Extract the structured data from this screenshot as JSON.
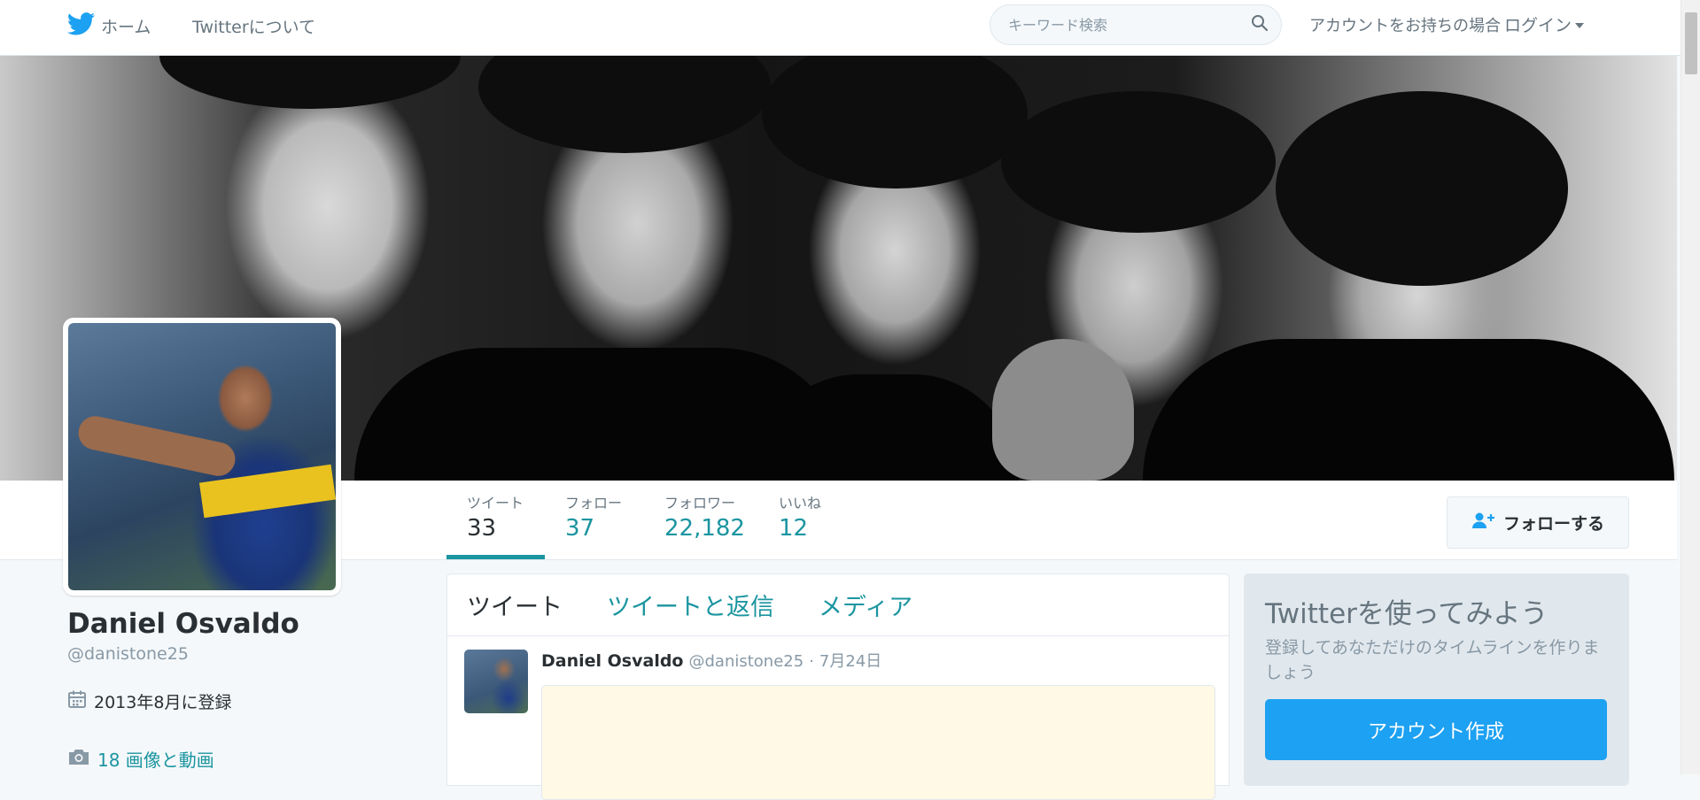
{
  "nav": {
    "home_label": "ホーム",
    "about_label": "Twitterについて",
    "search_placeholder": "キーワード検索",
    "login_prefix": "アカウントをお持ちの場合",
    "login_label": "ログイン"
  },
  "profile": {
    "fullname": "Daniel Osvaldo",
    "screenname": "@danistone25",
    "joined": "2013年8月に登録",
    "media_link": "18 画像と動画"
  },
  "stats": [
    {
      "label": "ツイート",
      "value": "33",
      "active": true
    },
    {
      "label": "フォロー",
      "value": "37",
      "active": false
    },
    {
      "label": "フォロワー",
      "value": "22,182",
      "active": false
    },
    {
      "label": "いいね",
      "value": "12",
      "active": false
    }
  ],
  "follow_button": "フォローする",
  "timeline": {
    "tabs": [
      "ツイート",
      "ツイートと返信",
      "メディア"
    ],
    "tweet": {
      "name": "Daniel Osvaldo",
      "handle": "@danistone25",
      "separator": "·",
      "date": "7月24日"
    }
  },
  "signup": {
    "title": "Twitterを使ってみよう",
    "subtitle": "登録してあなただけのタイムラインを作りましょう",
    "button": "アカウント作成"
  },
  "colors": {
    "accent": "#1b95a0",
    "twitter_blue": "#1da1f2",
    "text": "#292f33",
    "muted": "#66757f"
  },
  "icons": [
    "twitter-bird-icon",
    "search-icon",
    "caret-down-icon",
    "follow-user-icon",
    "calendar-icon",
    "camera-icon"
  ]
}
